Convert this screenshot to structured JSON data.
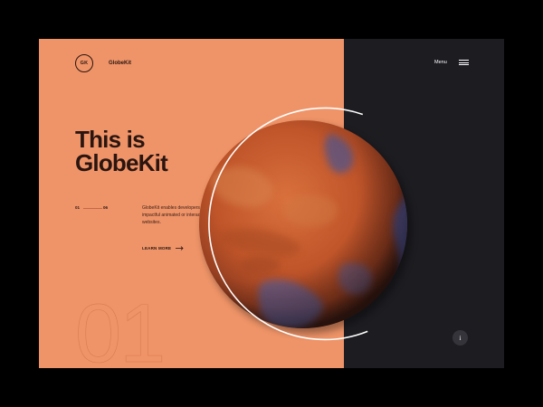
{
  "header": {
    "logo_initials": "GK",
    "brand_name": "GlobeKit",
    "menu_label": "Menu"
  },
  "hero": {
    "title_line1": "This is",
    "title_line2": "GlobeKit",
    "pager_current": "01",
    "pager_total": "06",
    "description": "GlobeKit enables developers to quickly add impactful animated or interactive globes to websites.",
    "cta_label": "LEARN MORE",
    "background_number": "01"
  },
  "info_button_label": "i",
  "colors": {
    "left_panel": "#ef9468",
    "right_panel": "#1d1c21",
    "text_dark": "#2a1510",
    "planet_red": "#c0552a",
    "planet_blue": "#48508e"
  },
  "icons": [
    "logo-circle",
    "arrow-right-icon",
    "hamburger-icon",
    "info-icon",
    "mars-globe"
  ]
}
